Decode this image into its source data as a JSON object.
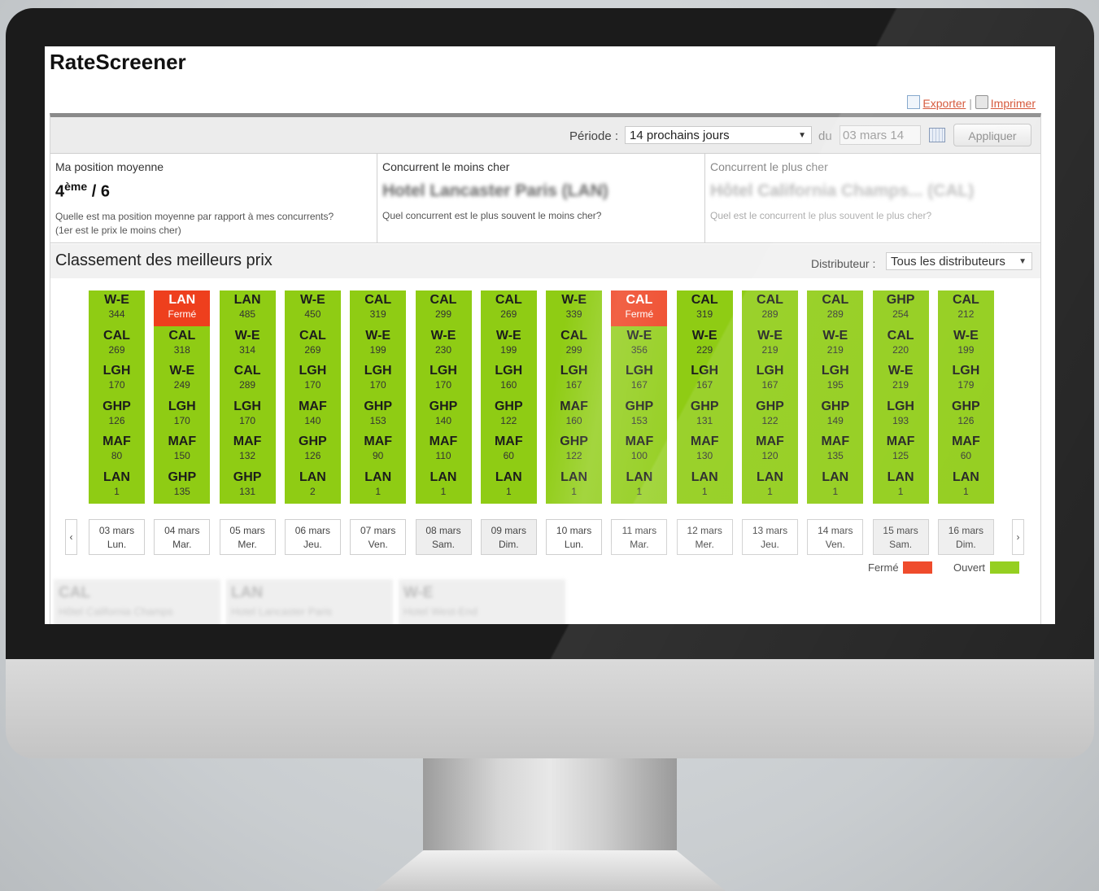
{
  "app": {
    "title": "RateScreener"
  },
  "actions": {
    "export_label": "Exporter",
    "separator": "|",
    "print_label": "Imprimer"
  },
  "filter": {
    "period_label": "Période :",
    "period_value": "14 prochains jours",
    "from_label": "du",
    "date_value": "03 mars 14",
    "apply_label": "Appliquer"
  },
  "stats": {
    "position": {
      "title": "Ma position moyenne",
      "rank": "4",
      "rank_suffix": "ème",
      "total": " / 6",
      "question_1": "Quelle est ma position moyenne par rapport à mes concurrents?",
      "question_2": "(1er est le prix le moins cher)"
    },
    "cheapest": {
      "title": "Concurrent le moins cher",
      "name": "Hotel Lancaster Paris (LAN)",
      "question": "Quel concurrent est le plus souvent le moins cher?"
    },
    "expensive": {
      "title": "Concurrent le plus cher",
      "name": "Hôtel California Champs... (CAL)",
      "question": "Quel est le concurrent le plus souvent le plus cher?"
    }
  },
  "ranking": {
    "title": "Classement des meilleurs prix",
    "distributor_label": "Distributeur :",
    "distributor_value": "Tous les distributeurs"
  },
  "colors": {
    "open": "#8fcc14",
    "closed": "#ee3f1d"
  },
  "days": [
    {
      "date": "03 mars",
      "weekday": "Lun.",
      "weekend": false,
      "ranks": [
        [
          "W-E",
          "344"
        ],
        [
          "CAL",
          "269"
        ],
        [
          "LGH",
          "170"
        ],
        [
          "GHP",
          "126"
        ],
        [
          "MAF",
          "80"
        ],
        [
          "LAN",
          "1"
        ]
      ]
    },
    {
      "date": "04 mars",
      "weekday": "Mar.",
      "weekend": false,
      "ranks": [
        [
          "LAN",
          "Fermé",
          "closed"
        ],
        [
          "CAL",
          "318"
        ],
        [
          "W-E",
          "249"
        ],
        [
          "LGH",
          "170"
        ],
        [
          "MAF",
          "150"
        ],
        [
          "GHP",
          "135"
        ]
      ]
    },
    {
      "date": "05 mars",
      "weekday": "Mer.",
      "weekend": false,
      "ranks": [
        [
          "LAN",
          "485"
        ],
        [
          "W-E",
          "314"
        ],
        [
          "CAL",
          "289"
        ],
        [
          "LGH",
          "170"
        ],
        [
          "MAF",
          "132"
        ],
        [
          "GHP",
          "131"
        ]
      ]
    },
    {
      "date": "06 mars",
      "weekday": "Jeu.",
      "weekend": false,
      "ranks": [
        [
          "W-E",
          "450"
        ],
        [
          "CAL",
          "269"
        ],
        [
          "LGH",
          "170"
        ],
        [
          "MAF",
          "140"
        ],
        [
          "GHP",
          "126"
        ],
        [
          "LAN",
          "2"
        ]
      ]
    },
    {
      "date": "07 mars",
      "weekday": "Ven.",
      "weekend": false,
      "ranks": [
        [
          "CAL",
          "319"
        ],
        [
          "W-E",
          "199"
        ],
        [
          "LGH",
          "170"
        ],
        [
          "GHP",
          "153"
        ],
        [
          "MAF",
          "90"
        ],
        [
          "LAN",
          "1"
        ]
      ]
    },
    {
      "date": "08 mars",
      "weekday": "Sam.",
      "weekend": true,
      "ranks": [
        [
          "CAL",
          "299"
        ],
        [
          "W-E",
          "230"
        ],
        [
          "LGH",
          "170"
        ],
        [
          "GHP",
          "140"
        ],
        [
          "MAF",
          "110"
        ],
        [
          "LAN",
          "1"
        ]
      ]
    },
    {
      "date": "09 mars",
      "weekday": "Dim.",
      "weekend": true,
      "ranks": [
        [
          "CAL",
          "269"
        ],
        [
          "W-E",
          "199"
        ],
        [
          "LGH",
          "160"
        ],
        [
          "GHP",
          "122"
        ],
        [
          "MAF",
          "60"
        ],
        [
          "LAN",
          "1"
        ]
      ]
    },
    {
      "date": "10 mars",
      "weekday": "Lun.",
      "weekend": false,
      "ranks": [
        [
          "W-E",
          "339"
        ],
        [
          "CAL",
          "299"
        ],
        [
          "LGH",
          "167"
        ],
        [
          "MAF",
          "160"
        ],
        [
          "GHP",
          "122"
        ],
        [
          "LAN",
          "1"
        ]
      ]
    },
    {
      "date": "11 mars",
      "weekday": "Mar.",
      "weekend": false,
      "ranks": [
        [
          "CAL",
          "Fermé",
          "closed"
        ],
        [
          "W-E",
          "356"
        ],
        [
          "LGH",
          "167"
        ],
        [
          "GHP",
          "153"
        ],
        [
          "MAF",
          "100"
        ],
        [
          "LAN",
          "1"
        ]
      ]
    },
    {
      "date": "12 mars",
      "weekday": "Mer.",
      "weekend": false,
      "ranks": [
        [
          "CAL",
          "319"
        ],
        [
          "W-E",
          "229"
        ],
        [
          "LGH",
          "167"
        ],
        [
          "GHP",
          "131"
        ],
        [
          "MAF",
          "130"
        ],
        [
          "LAN",
          "1"
        ]
      ]
    },
    {
      "date": "13 mars",
      "weekday": "Jeu.",
      "weekend": false,
      "ranks": [
        [
          "CAL",
          "289"
        ],
        [
          "W-E",
          "219"
        ],
        [
          "LGH",
          "167"
        ],
        [
          "GHP",
          "122"
        ],
        [
          "MAF",
          "120"
        ],
        [
          "LAN",
          "1"
        ]
      ]
    },
    {
      "date": "14 mars",
      "weekday": "Ven.",
      "weekend": false,
      "ranks": [
        [
          "CAL",
          "289"
        ],
        [
          "W-E",
          "219"
        ],
        [
          "LGH",
          "195"
        ],
        [
          "GHP",
          "149"
        ],
        [
          "MAF",
          "135"
        ],
        [
          "LAN",
          "1"
        ]
      ]
    },
    {
      "date": "15 mars",
      "weekday": "Sam.",
      "weekend": true,
      "ranks": [
        [
          "GHP",
          "254"
        ],
        [
          "CAL",
          "220"
        ],
        [
          "W-E",
          "219"
        ],
        [
          "LGH",
          "193"
        ],
        [
          "MAF",
          "125"
        ],
        [
          "LAN",
          "1"
        ]
      ]
    },
    {
      "date": "16 mars",
      "weekday": "Dim.",
      "weekend": true,
      "ranks": [
        [
          "CAL",
          "212"
        ],
        [
          "W-E",
          "199"
        ],
        [
          "LGH",
          "179"
        ],
        [
          "GHP",
          "126"
        ],
        [
          "MAF",
          "60"
        ],
        [
          "LAN",
          "1"
        ]
      ]
    }
  ],
  "nav": {
    "prev": "‹",
    "next": "›"
  },
  "legend": {
    "closed_label": "Fermé",
    "open_label": "Ouvert"
  },
  "hotels": [
    {
      "code": "CAL",
      "name": "Hôtel California Champs"
    },
    {
      "code": "LAN",
      "name": "Hotel Lancaster Paris"
    },
    {
      "code": "W-E",
      "name": "Hotel West-End"
    }
  ]
}
